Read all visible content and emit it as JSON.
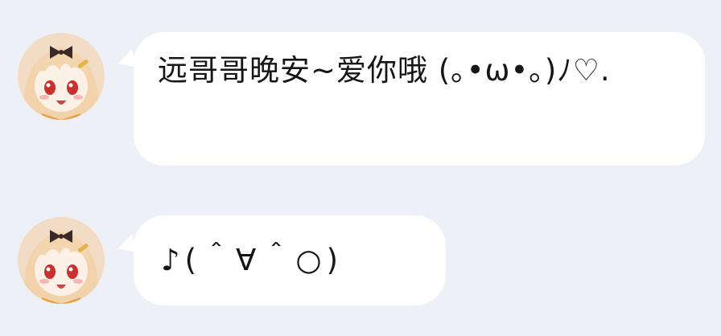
{
  "chat": {
    "messages": [
      {
        "sender_avatar": "anime-girl-avatar",
        "text": "远哥哥晚安~爱你哦 (｡•ω•｡)ﾉ♡."
      },
      {
        "sender_avatar": "anime-girl-avatar",
        "text": "♪(＾∀＾○)"
      }
    ]
  },
  "colors": {
    "background": "#eef0f7",
    "bubble": "#ffffff",
    "text": "#161616",
    "avatar_hair": "#f4d7b3",
    "avatar_eyes": "#d03a3a"
  }
}
